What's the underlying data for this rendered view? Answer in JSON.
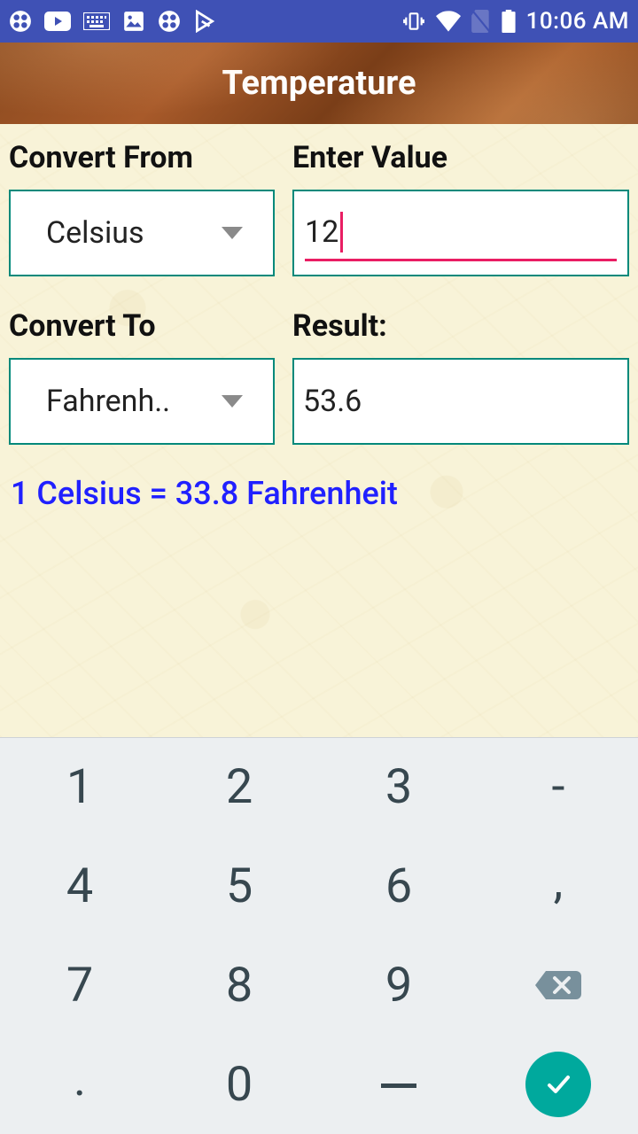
{
  "status": {
    "time": "10:06 AM"
  },
  "title": "Temperature",
  "labels": {
    "convert_from": "Convert From",
    "enter_value": "Enter Value",
    "convert_to": "Convert To",
    "result": "Result:"
  },
  "from_unit": "Celsius",
  "to_unit": "Fahrenh..",
  "input_value": "12",
  "result_value": "53.6",
  "equation": "1 Celsius = 33.8 Fahrenheit",
  "keypad": {
    "r1c1": "1",
    "r1c2": "2",
    "r1c3": "3",
    "r1c4": "-",
    "r2c1": "4",
    "r2c2": "5",
    "r2c3": "6",
    "r2c4": ",",
    "r3c1": "7",
    "r3c2": "8",
    "r3c3": "9",
    "r4c1": ".",
    "r4c2": "0",
    "r4c3": "_"
  }
}
